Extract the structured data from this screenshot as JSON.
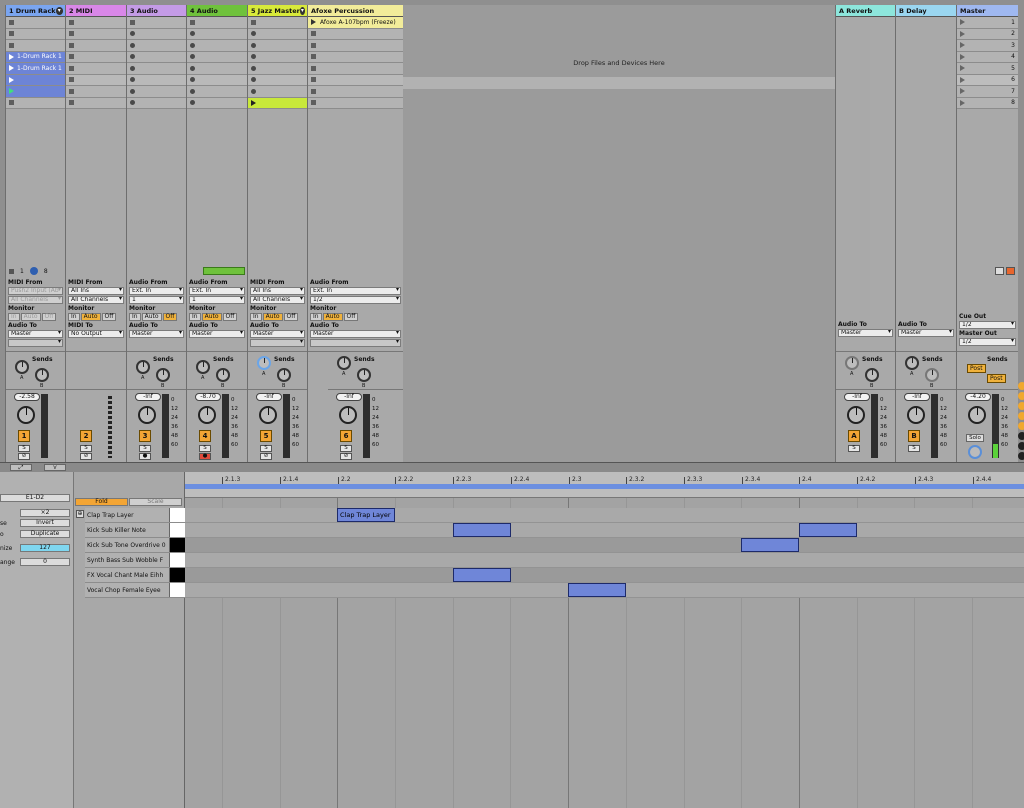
{
  "tracks": [
    {
      "name": "1 Drum Rack",
      "color": "#7aa5f0",
      "io_label": "MIDI From",
      "in1": "Push2 Input (Ab",
      "in2": "All Channels",
      "to": "Master",
      "vol": "-2.58",
      "num": "1",
      "monitor": [
        "In",
        "Auto",
        "Off"
      ],
      "mon_on": ""
    },
    {
      "name": "2 MIDI",
      "color": "#d987e8",
      "io_label": "MIDI From",
      "in1": "All Ins",
      "in2": "All Channels",
      "to": "No Output",
      "to_label": "MIDI To",
      "vol": "",
      "num": "2",
      "monitor": [
        "In",
        "Auto",
        "Off"
      ],
      "mon_on": "Auto"
    },
    {
      "name": "3 Audio",
      "color": "#c49be6",
      "io_label": "Audio From",
      "in1": "Ext. In",
      "in2": "1",
      "to": "Master",
      "vol": "-Inf",
      "num": "3",
      "monitor": [
        "In",
        "Auto",
        "Off"
      ],
      "mon_on": "Off"
    },
    {
      "name": "4 Audio",
      "color": "#6fc23c",
      "io_label": "Audio From",
      "in1": "Ext. In",
      "in2": "1",
      "to": "Master",
      "vol": "-8.70",
      "num": "4",
      "monitor": [
        "In",
        "Auto",
        "Off"
      ],
      "mon_on": "Auto"
    },
    {
      "name": "5 Jazz Master",
      "color": "#d8ea3a",
      "io_label": "MIDI From",
      "in1": "All Ins",
      "in2": "All Channels",
      "to": "Master",
      "vol": "-Inf",
      "num": "5",
      "monitor": [
        "In",
        "Auto",
        "Off"
      ],
      "mon_on": "Auto"
    },
    {
      "name": "Afoxe Percussion",
      "color": "#f2ec9a",
      "io_label": "Audio From",
      "in1": "Ext. In",
      "in2": "1/2",
      "to": "Master",
      "vol": "-Inf",
      "num": "6",
      "monitor": [
        "In",
        "Auto",
        "Off"
      ],
      "mon_on": "Auto"
    }
  ],
  "clips": {
    "drum1": "1-Drum Rack 1",
    "drum2": "1-Drum Rack 1",
    "afoxe": "Afoxe A-107bpm (Freeze)"
  },
  "drum_rack_ctrl": {
    "a": "1",
    "b": "8"
  },
  "labels": {
    "monitor": "Monitor",
    "audio_to": "Audio To",
    "sends": "Sends",
    "drop": "Drop Files and Devices Here",
    "cue_out": "Cue Out",
    "master_out": "Master Out",
    "post": "Post",
    "solo": "Solo",
    "s": "S",
    "a": "A",
    "b": "B"
  },
  "returns": [
    {
      "name": "A Reverb",
      "color": "#8de6dc",
      "to": "Master",
      "vol": "-Inf",
      "btn": "A"
    },
    {
      "name": "B Delay",
      "color": "#9ad6f0",
      "to": "Master",
      "vol": "-Inf",
      "btn": "B"
    }
  ],
  "master": {
    "name": "Master",
    "color": "#9fb8f0",
    "cue": "1/2",
    "out": "1/2",
    "vol": "-4.20",
    "slots": [
      "1",
      "2",
      "3",
      "4",
      "5",
      "6",
      "7",
      "8"
    ]
  },
  "scale_marks": [
    "0",
    "12",
    "24",
    "36",
    "48",
    "60"
  ],
  "piano": {
    "range": "E1-D2",
    "x2": "×2",
    "reverse": "Reverse",
    "invert": "Invert",
    "duplicate": "Duplicate",
    "velocity": "127",
    "range_val": "0",
    "lbl_quantize": "nize",
    "lbl_range": "ange",
    "lbl_se": "se",
    "lbl_o": "o",
    "fold": "Fold",
    "scale": "Scale",
    "rows": [
      "Clap Trap Layer",
      "Kick Sub Killer Note",
      "Kick Sub Tone Overdrive 0",
      "Synth Bass Sub Wobble F",
      "FX Vocal Chant Male Eihh",
      "Vocal Chop Female Eyee"
    ],
    "ticks": [
      "2.1.3",
      "2.1.4",
      "2.2",
      "2.2.2",
      "2.2.3",
      "2.2.4",
      "2.3",
      "2.3.2",
      "2.3.3",
      "2.3.4",
      "2.4",
      "2.4.2",
      "2.4.3",
      "2.4.4"
    ],
    "note_label": "Clap Trap Layer"
  }
}
